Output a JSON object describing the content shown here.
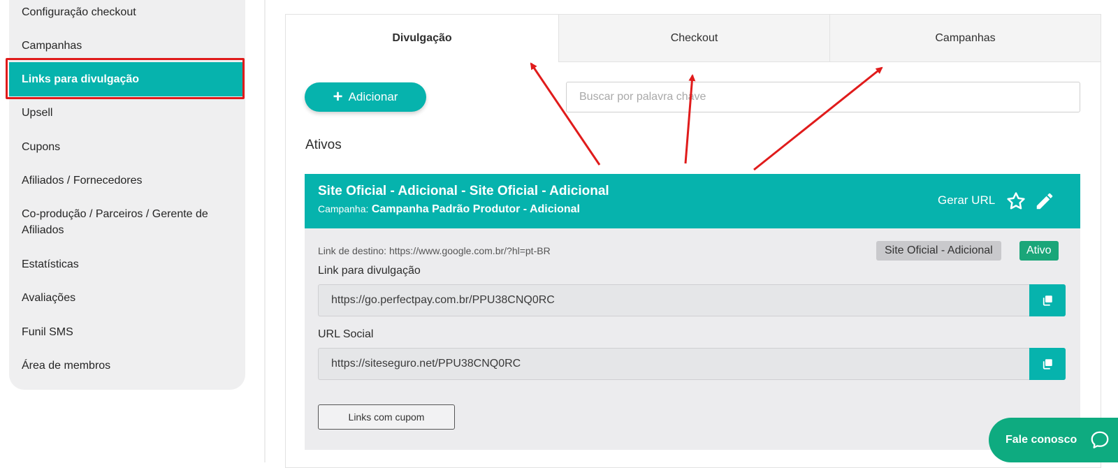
{
  "sidebar": {
    "items": [
      {
        "label": "Configuração checkout"
      },
      {
        "label": "Campanhas"
      },
      {
        "label": "Links para divulgação",
        "active": true
      },
      {
        "label": "Upsell"
      },
      {
        "label": "Cupons"
      },
      {
        "label": "Afiliados / Fornecedores"
      },
      {
        "label": "Co-produção / Parceiros / Gerente de Afiliados"
      },
      {
        "label": "Estatísticas"
      },
      {
        "label": "Avaliações"
      },
      {
        "label": "Funil SMS"
      },
      {
        "label": "Área de membros"
      }
    ]
  },
  "tabs": [
    {
      "label": "Divulgação",
      "active": true
    },
    {
      "label": "Checkout"
    },
    {
      "label": "Campanhas"
    }
  ],
  "toolbar": {
    "add_label": "Adicionar",
    "search_placeholder": "Buscar por palavra chave"
  },
  "section": {
    "title": "Ativos"
  },
  "link_card": {
    "title": "Site Oficial - Adicional - Site Oficial - Adicional",
    "campaign_label": "Campanha:",
    "campaign_value": "Campanha Padrão Produtor - Adicional",
    "gerar_url": "Gerar URL",
    "destination": "Link de destino: https://www.google.com.br/?hl=pt-BR",
    "badge_page": "Site Oficial - Adicional",
    "badge_status": "Ativo",
    "link_label": "Link para divulgação",
    "link_value": "https://go.perfectpay.com.br/PPU38CNQ0RC",
    "social_label": "URL Social",
    "social_value": "https://siteseguro.net/PPU38CNQ0RC",
    "cupom_button": "Links com cupom"
  },
  "chat": {
    "label": "Fale conosco"
  },
  "colors": {
    "primary": "#06b3ad",
    "status_green": "#1aa679",
    "chat_green": "#0eab80",
    "annotation_red": "#e01b1b"
  }
}
